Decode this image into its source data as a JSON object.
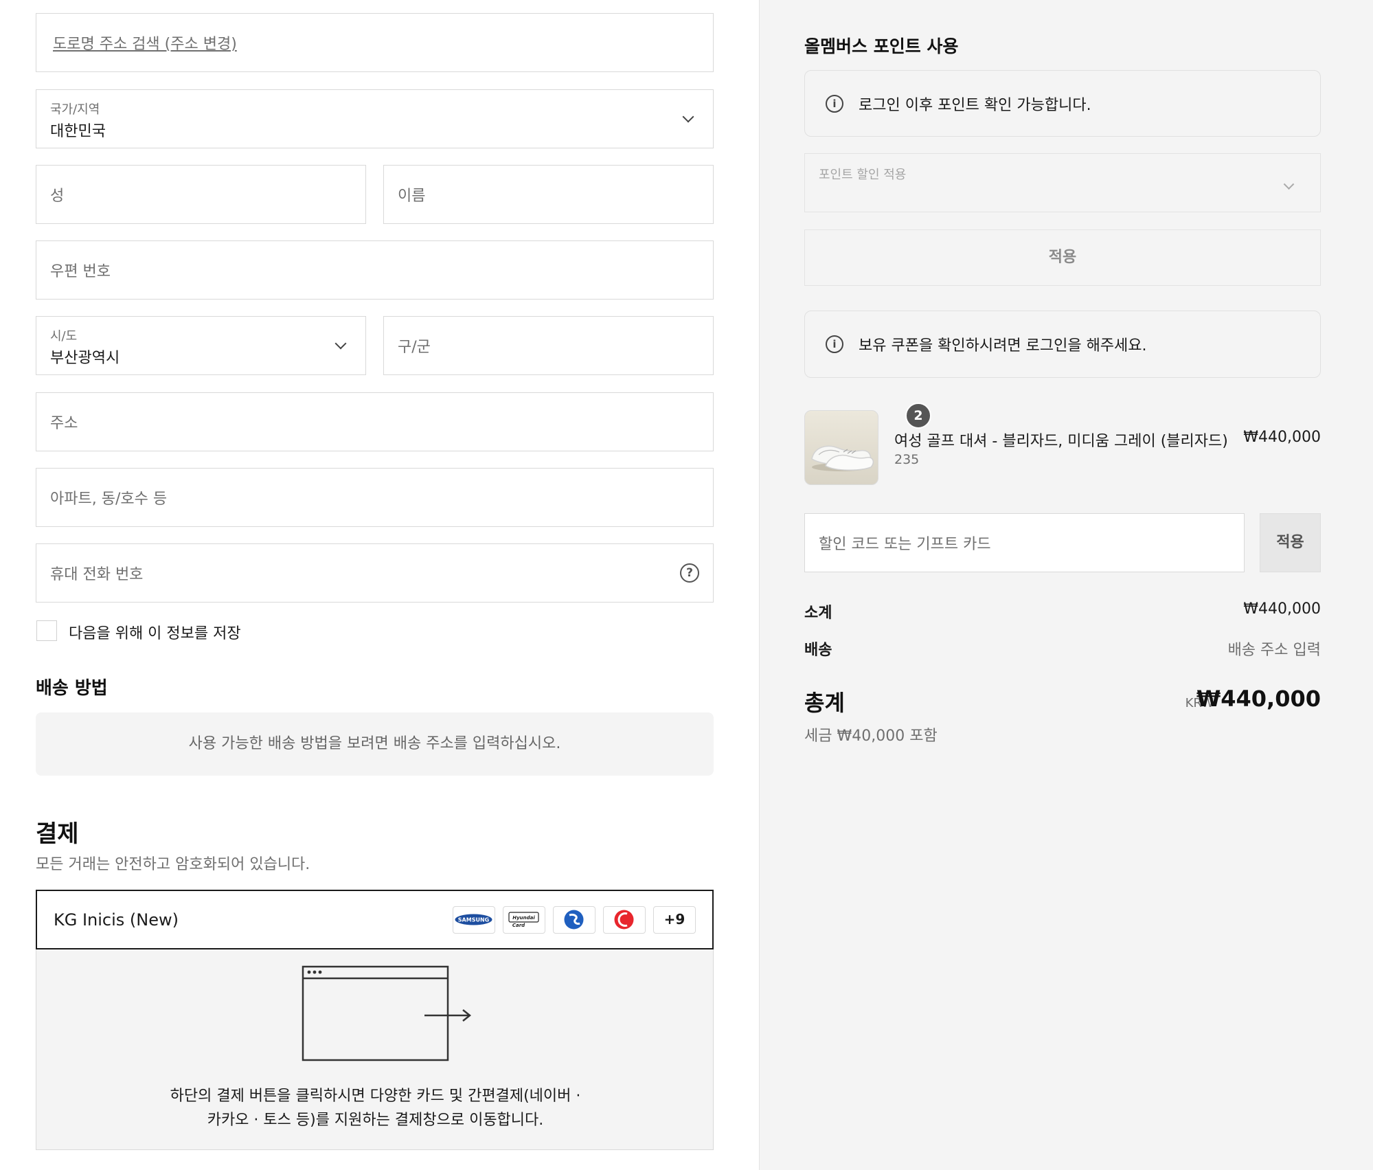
{
  "shipping_form": {
    "address_search_link": "도로명 주소 검색 (주소 변경)",
    "country": {
      "label": "국가/지역",
      "value": "대한민국"
    },
    "last_name_placeholder": "성",
    "first_name_placeholder": "이름",
    "postal_code_placeholder": "우편 번호",
    "province": {
      "label": "시/도",
      "value": "부산광역시"
    },
    "district_placeholder": "구/군",
    "address_placeholder": "주소",
    "address2_placeholder": "아파트, 동/호수 등",
    "phone_placeholder": "휴대 전화 번호",
    "save_info_label": "다음을 위해 이 정보를 저장",
    "help_icon": "?"
  },
  "shipping_method": {
    "title": "배송 방법",
    "notice": "사용 가능한 배송 방법을 보려면 배송 주소를 입력하십시오."
  },
  "payment": {
    "title": "결제",
    "subtitle": "모든 거래는 안전하고 암호화되어 있습니다.",
    "provider_name": "KG Inicis (New)",
    "card_logos": [
      "samsung-card",
      "hyundai-card",
      "shinhan-card",
      "bc-card"
    ],
    "samsung_text": "SAMSUNG",
    "hyundai_text_1": "Hyundai",
    "hyundai_text_2": "Card",
    "more_cards": "+9",
    "description_line1": "하단의 결제 버튼을 클릭하시면 다양한 카드 및 간편결제(네이버 ·",
    "description_line2": "카카오 · 토스 등)를 지원하는 결제창으로 이동합니다."
  },
  "summary": {
    "points_title": "올멤버스 포인트 사용",
    "points_login_notice": "로그인 이후 포인트 확인 가능합니다.",
    "points_select_label": "포인트 할인 적용",
    "points_apply_label": "적용",
    "coupon_notice": "보유 쿠폰을 확인하시려면 로그인을 해주세요.",
    "info_icon": "i",
    "product": {
      "quantity": "2",
      "name": "여성 골프 대셔 - 블리자드, 미디움 그레이 (블리자드)",
      "variant": "235",
      "price": "₩440,000"
    },
    "discount_placeholder": "할인 코드 또는 기프트 카드",
    "discount_apply_label": "적용",
    "subtotal_label": "소계",
    "subtotal_value": "₩440,000",
    "shipping_label": "배송",
    "shipping_value": "배송 주소 입력",
    "total_label": "총계",
    "total_currency": "KRW",
    "total_value": "₩440,000",
    "tax_note": "세금 ₩40,000 포함"
  },
  "colors": {
    "accent_dark": "#1a1a1a",
    "panel_bg": "#f4f4f4",
    "border": "#d9d9d9",
    "muted_text": "#6f6f6f"
  }
}
